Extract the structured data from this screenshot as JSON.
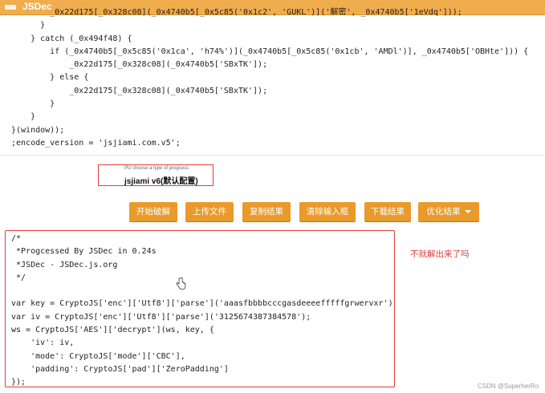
{
  "header": {
    "brand": "JSDec",
    "bg_color": "#f0ad4e"
  },
  "top_code": "        _0x22d175[_0x328c08](_0x4740b5[_0x5c85('0x1c2', 'GUKL')]('解密', _0x4740b5['1eVdq']));\n      }\n    } catch (_0x494f48) {\n        if (_0x4740b5[_0x5c85('0x1ca', 'h74%')](_0x4740b5[_0x5c85('0x1cb', 'AMDl')], _0x4740b5['OBHte'])) {\n            _0x22d175[_0x328c08](_0x4740b5['SBxTK']);\n        } else {\n            _0x22d175[_0x328c08](_0x4740b5['SBxTK']);\n        }\n    }\n}(window));\n;encode_version = 'jsjiami.com.v5';",
  "type_select": {
    "hint": "Plz choose a type of progcess",
    "value": "jsjiami v6(默认配置)"
  },
  "buttons": {
    "start": "开始破解",
    "upload": "上传文件",
    "copy": "复制结果",
    "clear": "清除输入框",
    "download": "下载结果",
    "optimize": "优化结果"
  },
  "button_color": "#e99a2a",
  "output_code": "/*\n *Progcessed By JSDec in 0.24s\n *JSDec - JSDec.js.org\n */\n\nvar key = CryptoJS['enc']['Utf8']['parse']('aaasfbbbbcccgasdeeeefffffgrwervxr');\nvar iv = CryptoJS['enc']['Utf8']['parse']('3125674387384578');\nws = CryptoJS['AES']['decrypt'](ws, key, {\n    'iv': iv,\n    'mode': CryptoJS['mode']['CBC'],\n    'padding': CryptoJS['pad']['ZeroPadding']\n});\nts = CryptoJS['AES']['decrypt'](ts, key, {",
  "annotation": "不就解出来了吗",
  "annotation_color": "#e43b3b",
  "watermark": "CSDN @SuperherRo"
}
